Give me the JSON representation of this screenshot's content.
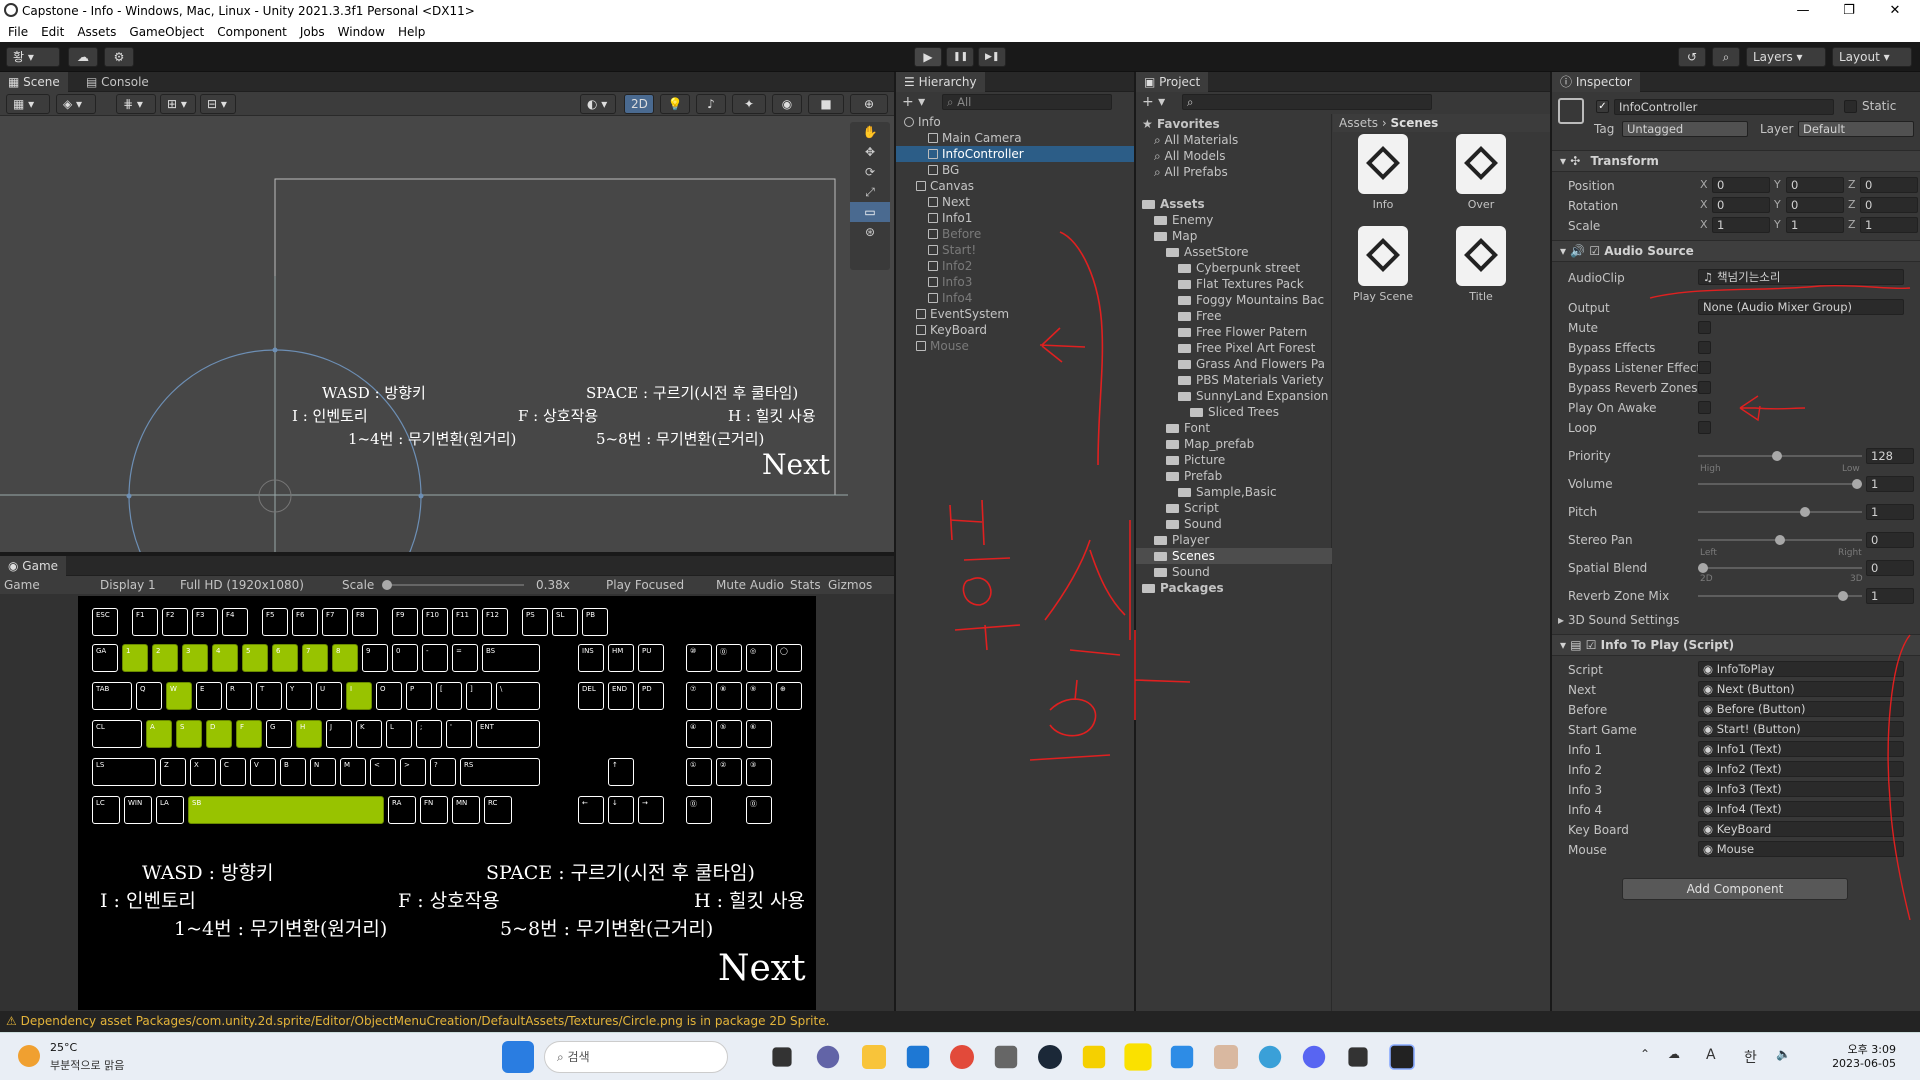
{
  "window": {
    "title": "Capstone - Info - Windows, Mac, Linux - Unity 2021.3.3f1 Personal <DX11>",
    "min": "—",
    "max": "❐",
    "close": "✕"
  },
  "menu": [
    "File",
    "Edit",
    "Assets",
    "GameObject",
    "Component",
    "Jobs",
    "Window",
    "Help"
  ],
  "toolbar": {
    "account": "황 ▾",
    "layers": "Layers",
    "layout": "Layout",
    "play": "▶",
    "pause": "❚❚",
    "step": "▶❚"
  },
  "scene": {
    "tabs": [
      "Scene",
      "Console"
    ],
    "mode2d": "2D",
    "texts": {
      "wasd": "WASD : 방향키",
      "space": "SPACE : 구르기(시전 후 쿨타임)",
      "i": "I : 인벤토리",
      "f": "F : 상호작용",
      "h": "H : 힐킷 사용",
      "n14": "1~4번 : 무기변환(원거리)",
      "n58": "5~8번 : 무기변환(근거리)",
      "next": "Next"
    }
  },
  "game": {
    "tab": "Game",
    "display_mode": "Game",
    "display": "Display 1",
    "resolution": "Full HD (1920x1080)",
    "scale_label": "Scale",
    "scale_value": "0.38x",
    "play_focused": "Play Focused",
    "mute": "Mute Audio",
    "stats": "Stats",
    "gizmos": "Gizmos",
    "texts": {
      "wasd": "WASD : 방향키",
      "space": "SPACE : 구르기(시전 후 쿨타임)",
      "i": "I : 인벤토리",
      "f": "F : 상호작용",
      "h": "H : 힐킷 사용",
      "n14": "1~4번 : 무기변환(원거리)",
      "n58": "5~8번 : 무기변환(근거리)",
      "next": "Next"
    }
  },
  "hierarchy": {
    "tab": "Hierarchy",
    "search": "All",
    "items": [
      {
        "label": "Info",
        "depth": 0,
        "state": "scene"
      },
      {
        "label": "Main Camera",
        "depth": 2,
        "state": "normal"
      },
      {
        "label": "InfoController",
        "depth": 2,
        "state": "selected"
      },
      {
        "label": "BG",
        "depth": 2,
        "state": "normal"
      },
      {
        "label": "Canvas",
        "depth": 1,
        "state": "normal"
      },
      {
        "label": "Next",
        "depth": 2,
        "state": "normal"
      },
      {
        "label": "Info1",
        "depth": 2,
        "state": "normal"
      },
      {
        "label": "Before",
        "depth": 2,
        "state": "dim"
      },
      {
        "label": "Start!",
        "depth": 2,
        "state": "dim"
      },
      {
        "label": "Info2",
        "depth": 2,
        "state": "dim"
      },
      {
        "label": "Info3",
        "depth": 2,
        "state": "dim"
      },
      {
        "label": "Info4",
        "depth": 2,
        "state": "dim"
      },
      {
        "label": "EventSystem",
        "depth": 1,
        "state": "normal"
      },
      {
        "label": "KeyBoard",
        "depth": 1,
        "state": "normal"
      },
      {
        "label": "Mouse",
        "depth": 1,
        "state": "dim"
      }
    ]
  },
  "project": {
    "tab": "Project",
    "breadcrumb": [
      "Assets",
      "Scenes"
    ],
    "tree": [
      {
        "label": "Favorites",
        "depth": 0,
        "bold": true
      },
      {
        "label": "All Materials",
        "depth": 1
      },
      {
        "label": "All Models",
        "depth": 1
      },
      {
        "label": "All Prefabs",
        "depth": 1
      },
      {
        "label": "",
        "depth": 0
      },
      {
        "label": "Assets",
        "depth": 0,
        "bold": true
      },
      {
        "label": "Enemy",
        "depth": 1
      },
      {
        "label": "Map",
        "depth": 1
      },
      {
        "label": "AssetStore",
        "depth": 2
      },
      {
        "label": "Cyberpunk street",
        "depth": 3
      },
      {
        "label": "Flat Textures Pack",
        "depth": 3
      },
      {
        "label": "Foggy Mountains Bac",
        "depth": 3
      },
      {
        "label": "Free",
        "depth": 3
      },
      {
        "label": "Free Flower Patern",
        "depth": 3
      },
      {
        "label": "Free Pixel Art Forest",
        "depth": 3
      },
      {
        "label": "Grass And Flowers Pa",
        "depth": 3
      },
      {
        "label": "PBS Materials Variety",
        "depth": 3
      },
      {
        "label": "SunnyLand Expansion",
        "depth": 3
      },
      {
        "label": "Sliced Trees",
        "depth": 4
      },
      {
        "label": "Font",
        "depth": 2
      },
      {
        "label": "Map_prefab",
        "depth": 2
      },
      {
        "label": "Picture",
        "depth": 2
      },
      {
        "label": "Prefab",
        "depth": 2
      },
      {
        "label": "Sample,Basic",
        "depth": 3
      },
      {
        "label": "Script",
        "depth": 2
      },
      {
        "label": "Sound",
        "depth": 2
      },
      {
        "label": "Player",
        "depth": 1
      },
      {
        "label": "Scenes",
        "depth": 1,
        "selected": true
      },
      {
        "label": "Sound",
        "depth": 1
      },
      {
        "label": "Packages",
        "depth": 0,
        "bold": true
      }
    ],
    "assets": [
      "Info",
      "Over",
      "Play Scene",
      "Title"
    ]
  },
  "inspector": {
    "tab": "Inspector",
    "object_name": "InfoController",
    "static": "Static",
    "tag_label": "Tag",
    "tag": "Untagged",
    "layer_label": "Layer",
    "layer": "Default",
    "transform": {
      "title": "Transform",
      "position_label": "Position",
      "rotation_label": "Rotation",
      "scale_label": "Scale",
      "position": [
        "0",
        "0",
        "0"
      ],
      "rotation": [
        "0",
        "0",
        "0"
      ],
      "scale": [
        "1",
        "1",
        "1"
      ]
    },
    "audio": {
      "title": "Audio Source",
      "clip_label": "AudioClip",
      "clip": "책넘기는소리",
      "output_label": "Output",
      "output": "None (Audio Mixer Group)",
      "mute": "Mute",
      "bypass_effects": "Bypass Effects",
      "bypass_listener": "Bypass Listener Effect",
      "bypass_reverb": "Bypass Reverb Zones",
      "play_on_awake": "Play On Awake",
      "loop": "Loop",
      "priority_label": "Priority",
      "priority": "128",
      "high": "High",
      "low": "Low",
      "volume_label": "Volume",
      "volume": "1",
      "pitch_label": "Pitch",
      "pitch": "1",
      "pan_label": "Stereo Pan",
      "pan": "0",
      "left": "Left",
      "right": "Right",
      "blend_label": "Spatial Blend",
      "blend": "0",
      "d2": "2D",
      "d3": "3D",
      "reverb_label": "Reverb Zone Mix",
      "reverb": "1",
      "sound3d": "3D Sound Settings"
    },
    "script": {
      "title": "Info To Play (Script)",
      "fields": [
        {
          "label": "Script",
          "value": "InfoToPlay"
        },
        {
          "label": "Next",
          "value": "Next (Button)"
        },
        {
          "label": "Before",
          "value": "Before (Button)"
        },
        {
          "label": "Start Game",
          "value": "Start! (Button)"
        },
        {
          "label": "Info 1",
          "value": "Info1 (Text)"
        },
        {
          "label": "Info 2",
          "value": "Info2 (Text)"
        },
        {
          "label": "Info 3",
          "value": "Info3 (Text)"
        },
        {
          "label": "Info 4",
          "value": "Info4 (Text)"
        },
        {
          "label": "Key Board",
          "value": "KeyBoard"
        },
        {
          "label": "Mouse",
          "value": "Mouse"
        }
      ]
    },
    "add_component": "Add Component"
  },
  "status": {
    "text": "Dependency asset Packages/com.unity.2d.sprite/Editor/ObjectMenuCreation/DefaultAssets/Textures/Circle.png is in package 2D Sprite."
  },
  "taskbar": {
    "temp": "25°C",
    "weather": "부분적으로 맑음",
    "search": "검색",
    "time": "오후 3:09",
    "date": "2023-06-05",
    "ime1": "A",
    "ime2": "한"
  }
}
